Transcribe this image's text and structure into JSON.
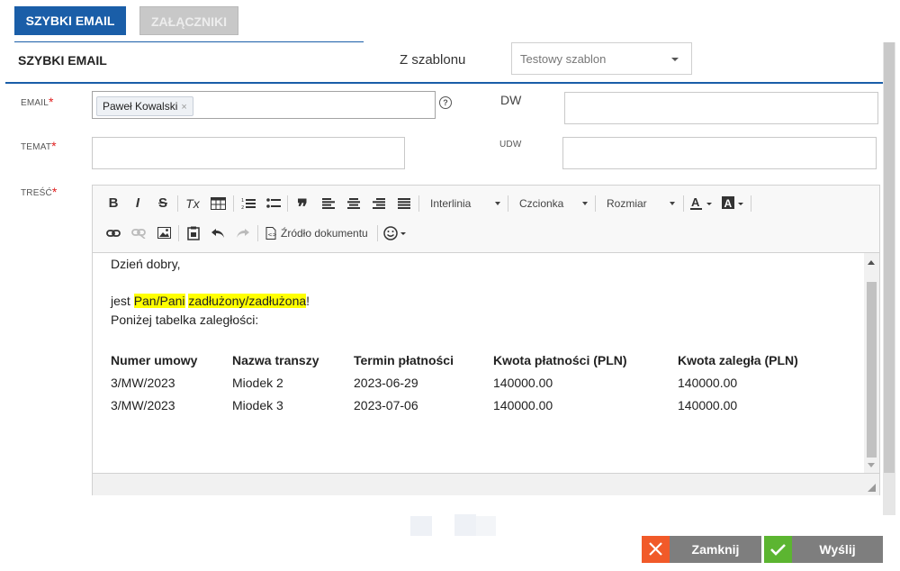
{
  "tabs": [
    {
      "label": "SZYBKI EMAIL",
      "active": true
    },
    {
      "label": "ZAŁĄCZNIKI",
      "active": false
    }
  ],
  "header": {
    "title": "SZYBKI EMAIL",
    "template_label": "Z szablonu",
    "template_value": "Testowy szablon"
  },
  "form": {
    "email_label": "EMAIL",
    "email_chip": "Paweł Kowalski",
    "chip_remove": "×",
    "help": "?",
    "required_mark": "*",
    "temat_label": "TEMAT",
    "tresc_label": "TREŚĆ",
    "dw_label": "DW",
    "udw_label": "UDW"
  },
  "toolbar": {
    "bold": "B",
    "italic": "I",
    "strike": "S",
    "clear_format": "Tx",
    "interlinia": "Interlinia",
    "czcionka": "Czcionka",
    "rozmiar": "Rozmiar",
    "zrodlo": "Źródło dokumentu"
  },
  "body": {
    "greeting": "Dzień dobry,",
    "line_prefix": "jest ",
    "highlight1": "Pan/Pani",
    "space": " ",
    "highlight2": "zadłużony/zadłużona",
    "line_suffix": "!",
    "intro": "Poniżej tabelka zaległości:",
    "table_headers": [
      "Numer umowy",
      "Nazwa transzy",
      "Termin płatności",
      "Kwota płatności (PLN)",
      "Kwota zaległa (PLN)"
    ],
    "rows": [
      [
        "3/MW/2023",
        "Miodek 2",
        "2023-06-29",
        "140000.00",
        "140000.00"
      ],
      [
        "3/MW/2023",
        "Miodek 3",
        "2023-07-06",
        "140000.00",
        "140000.00"
      ]
    ]
  },
  "buttons": {
    "close": "Zamknij",
    "send": "Wyślij"
  },
  "colors": {
    "primary": "#1a5ea8",
    "close_icon_bg": "#f15a29",
    "send_icon_bg": "#5cb531",
    "button_bg": "#7e7e7e",
    "required": "#e02020",
    "highlight": "#ffff00"
  }
}
